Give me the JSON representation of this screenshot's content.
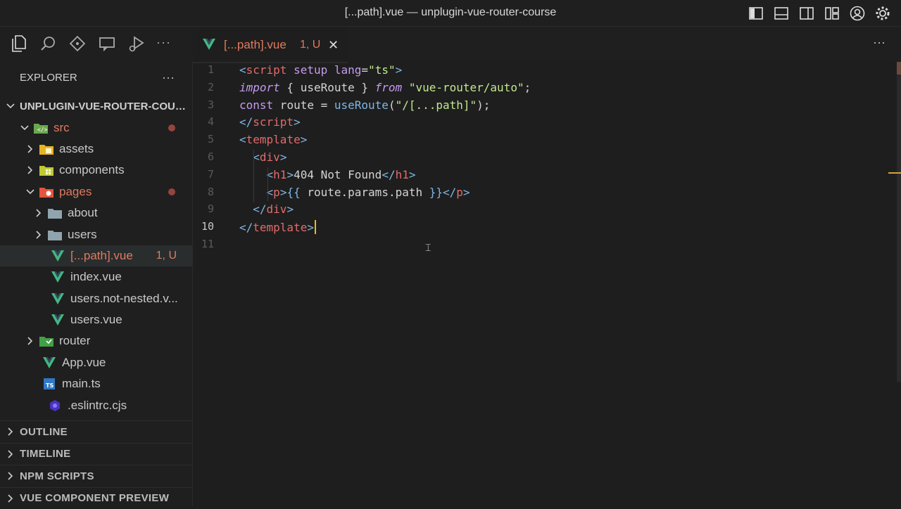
{
  "window": {
    "title": "[...path].vue — unplugin-vue-router-course"
  },
  "activity_bar": {
    "icons": [
      "files-icon",
      "search-icon",
      "source-control-icon",
      "remote-explorer-icon",
      "run-debug-icon"
    ],
    "more": "···"
  },
  "explorer": {
    "title": "EXPLORER",
    "more": "···",
    "project": "UNPLUGIN-VUE-ROUTER-COURSE",
    "tree": [
      {
        "label": "src",
        "indent": 1,
        "type": "folder",
        "open": true,
        "icon": "folder-src-icon",
        "color": "#e07a5f",
        "modified": true
      },
      {
        "label": "assets",
        "indent": 2,
        "type": "folder",
        "open": false,
        "icon": "folder-assets-icon"
      },
      {
        "label": "components",
        "indent": 2,
        "type": "folder",
        "open": false,
        "icon": "folder-components-icon"
      },
      {
        "label": "pages",
        "indent": 2,
        "type": "folder",
        "open": true,
        "icon": "folder-pages-icon",
        "color": "#e07a5f",
        "modified": true
      },
      {
        "label": "about",
        "indent": 3,
        "type": "folder",
        "open": false,
        "icon": "folder-icon"
      },
      {
        "label": "users",
        "indent": 3,
        "type": "folder",
        "open": false,
        "icon": "folder-icon"
      },
      {
        "label": "[...path].vue",
        "indent": 3,
        "type": "file",
        "icon": "vue-icon",
        "color": "#e07a5f",
        "badge": "1, U",
        "selected": true
      },
      {
        "label": "index.vue",
        "indent": 3,
        "type": "file",
        "icon": "vue-icon"
      },
      {
        "label": "users.not-nested.v...",
        "indent": 3,
        "type": "file",
        "icon": "vue-icon"
      },
      {
        "label": "users.vue",
        "indent": 3,
        "type": "file",
        "icon": "vue-icon"
      },
      {
        "label": "router",
        "indent": 2,
        "type": "folder",
        "open": false,
        "icon": "folder-router-icon"
      },
      {
        "label": "App.vue",
        "indent": 2,
        "type": "file",
        "icon": "vue-icon"
      },
      {
        "label": "main.ts",
        "indent": 2,
        "type": "file",
        "icon": "typescript-icon"
      },
      {
        "label": ".eslintrc.cjs",
        "indent": 1,
        "type": "file",
        "icon": "eslint-icon"
      }
    ],
    "sections": [
      "OUTLINE",
      "TIMELINE",
      "NPM SCRIPTS",
      "VUE COMPONENT PREVIEW"
    ]
  },
  "editor": {
    "tab": {
      "label": "[...path].vue",
      "badge": "1, U",
      "close": "✕"
    },
    "tabs_more": "···",
    "active_line": 10,
    "lines": [
      [
        [
          "tk-tag",
          "<"
        ],
        [
          "tk-el",
          "script"
        ],
        [
          "tk-p",
          " "
        ],
        [
          "tk-attr",
          "setup"
        ],
        [
          "tk-p",
          " "
        ],
        [
          "tk-attr",
          "lang"
        ],
        [
          "tk-p",
          "="
        ],
        [
          "tk-str",
          "\"ts\""
        ],
        [
          "tk-tag",
          ">"
        ]
      ],
      [
        [
          "tk-kw",
          "import"
        ],
        [
          "tk-p",
          " { useRoute } "
        ],
        [
          "tk-kw",
          "from"
        ],
        [
          "tk-p",
          " "
        ],
        [
          "tk-str",
          "\"vue-router/auto\""
        ],
        [
          "tk-p",
          ";"
        ]
      ],
      [
        [
          "tk-kw2",
          "const"
        ],
        [
          "tk-p",
          " route = "
        ],
        [
          "tk-fn",
          "useRoute"
        ],
        [
          "tk-p",
          "("
        ],
        [
          "tk-str",
          "\"/[...path]\""
        ],
        [
          "tk-p",
          ");"
        ]
      ],
      [
        [
          "tk-tag",
          "</"
        ],
        [
          "tk-el",
          "script"
        ],
        [
          "tk-tag",
          ">"
        ]
      ],
      [
        [
          "tk-tag",
          "<"
        ],
        [
          "tk-el",
          "template"
        ],
        [
          "tk-tag",
          ">"
        ]
      ],
      [
        [
          "tk-p",
          "  "
        ],
        [
          "tk-tag",
          "<"
        ],
        [
          "tk-el",
          "div"
        ],
        [
          "tk-tag",
          ">"
        ]
      ],
      [
        [
          "tk-p",
          "    "
        ],
        [
          "tk-tag",
          "<"
        ],
        [
          "tk-el",
          "h1"
        ],
        [
          "tk-tag",
          ">"
        ],
        [
          "tk-p",
          "404 Not Found"
        ],
        [
          "tk-tag",
          "</"
        ],
        [
          "tk-el",
          "h1"
        ],
        [
          "tk-tag",
          ">"
        ]
      ],
      [
        [
          "tk-p",
          "    "
        ],
        [
          "tk-tag",
          "<"
        ],
        [
          "tk-el",
          "p"
        ],
        [
          "tk-tag",
          ">"
        ],
        [
          "tk-fn",
          "{{"
        ],
        [
          "tk-p",
          " route.params.path "
        ],
        [
          "tk-fn",
          "}}"
        ],
        [
          "tk-tag",
          "</"
        ],
        [
          "tk-el",
          "p"
        ],
        [
          "tk-tag",
          ">"
        ]
      ],
      [
        [
          "tk-p",
          "  "
        ],
        [
          "tk-tag",
          "</"
        ],
        [
          "tk-el",
          "div"
        ],
        [
          "tk-tag",
          ">"
        ]
      ],
      [
        [
          "tk-tag",
          "</"
        ],
        [
          "tk-el",
          "template"
        ],
        [
          "tk-tag",
          ">"
        ]
      ],
      []
    ]
  }
}
